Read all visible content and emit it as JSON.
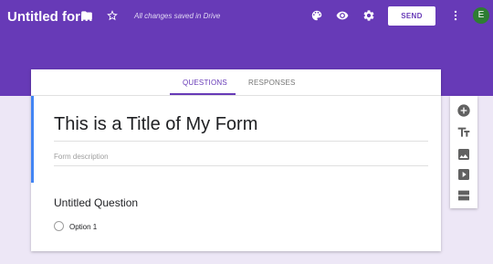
{
  "header": {
    "form_title": "Untitled form",
    "saved_status": "All changes saved in Drive",
    "send_label": "SEND",
    "avatar_initial": "E",
    "icons": [
      "folder-icon",
      "star-icon",
      "palette-icon",
      "eye-icon",
      "gear-icon",
      "more-vert-icon"
    ]
  },
  "tabs": [
    {
      "label": "QUESTIONS",
      "active": true
    },
    {
      "label": "RESPONSES",
      "active": false
    }
  ],
  "form": {
    "title": "This is a Title of My Form",
    "description_placeholder": "Form description"
  },
  "question": {
    "title": "Untitled Question",
    "options": [
      "Option 1"
    ]
  },
  "side_toolbar": {
    "icons": [
      "add-question-icon",
      "add-title-icon",
      "add-image-icon",
      "add-video-icon",
      "add-section-icon"
    ]
  },
  "colors": {
    "theme": "#673ab7",
    "background": "#ede7f6",
    "accent_bar": "#4285f4",
    "avatar": "#2e7d32"
  }
}
